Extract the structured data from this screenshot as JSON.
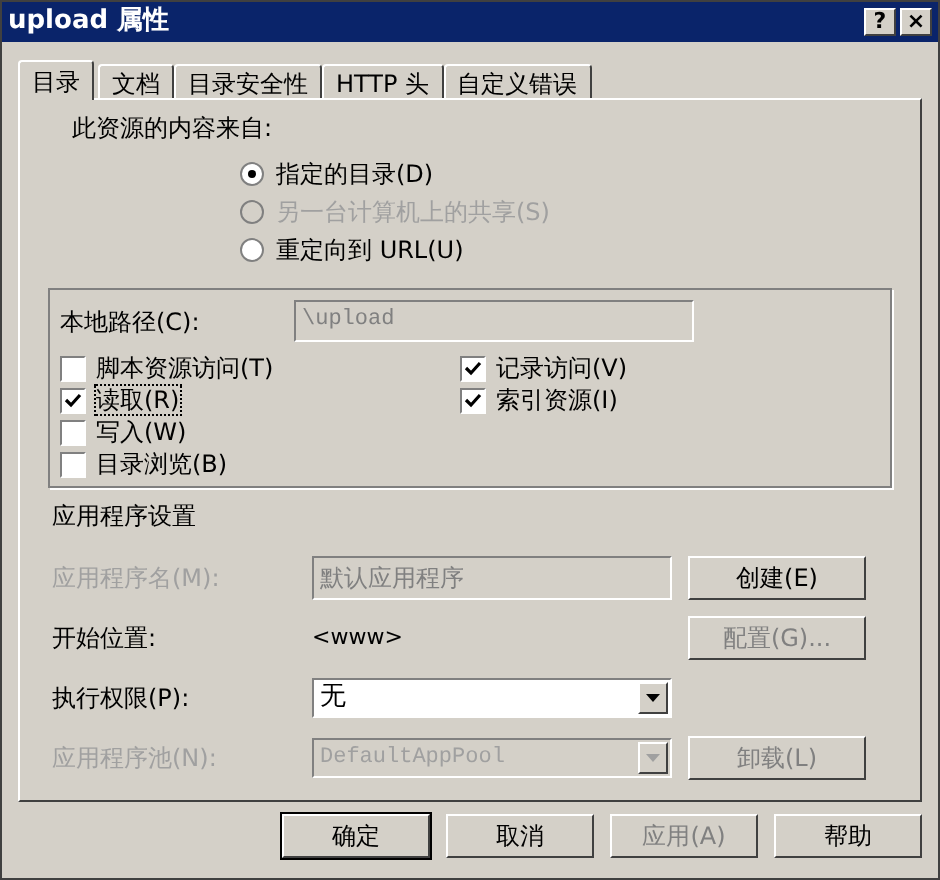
{
  "window": {
    "title": "upload 属性",
    "buttons": [
      {
        "label": "?"
      },
      {
        "label": "×"
      }
    ]
  },
  "tabs": [
    {
      "label": "目录",
      "selected": true
    },
    {
      "label": "文档",
      "selected": false
    },
    {
      "label": "目录安全性",
      "selected": false
    },
    {
      "label": "HTTP 头",
      "selected": false
    },
    {
      "label": "自定义错误",
      "selected": false
    }
  ],
  "content_source": {
    "label": "此资源的内容来自:",
    "options": [
      {
        "label": "指定的目录(D)",
        "selected": true,
        "disabled": false
      },
      {
        "label": "另一台计算机上的共享(S)",
        "selected": false,
        "disabled": true
      },
      {
        "label": "重定向到 URL(U)",
        "selected": false,
        "disabled": false
      }
    ]
  },
  "local_path": {
    "label": "本地路径(C):",
    "value": "\\upload",
    "disabled": true
  },
  "permissions_left": [
    {
      "label": "脚本资源访问(T)",
      "checked": false,
      "focused": false
    },
    {
      "label": "读取(R)",
      "checked": true,
      "focused": true
    },
    {
      "label": "写入(W)",
      "checked": false,
      "focused": false
    },
    {
      "label": "目录浏览(B)",
      "checked": false,
      "focused": false
    }
  ],
  "permissions_right": [
    {
      "label": "记录访问(V)",
      "checked": true,
      "focused": false
    },
    {
      "label": "索引资源(I)",
      "checked": true,
      "focused": false
    }
  ],
  "app_settings": {
    "title": "应用程序设置",
    "rows": [
      {
        "kind": "text",
        "label": "应用程序名(M):",
        "value": "默认应用程序",
        "disabled": true,
        "button": {
          "label": "创建(E)",
          "disabled": false
        }
      },
      {
        "kind": "static",
        "label": "开始位置:",
        "value": "<www>",
        "disabled": false,
        "button": {
          "label": "配置(G)...",
          "disabled": true
        }
      },
      {
        "kind": "select",
        "label": "执行权限(P):",
        "value": "无",
        "disabled": false
      },
      {
        "kind": "select",
        "label": "应用程序池(N):",
        "value": "DefaultAppPool",
        "disabled": true,
        "button": {
          "label": "卸载(L)",
          "disabled": true
        }
      }
    ]
  },
  "footer_buttons": [
    {
      "label": "确定",
      "disabled": false,
      "default": true
    },
    {
      "label": "取消",
      "disabled": false,
      "default": false
    },
    {
      "label": "应用(A)",
      "disabled": true,
      "default": false
    },
    {
      "label": "帮助",
      "disabled": false,
      "default": false
    }
  ]
}
